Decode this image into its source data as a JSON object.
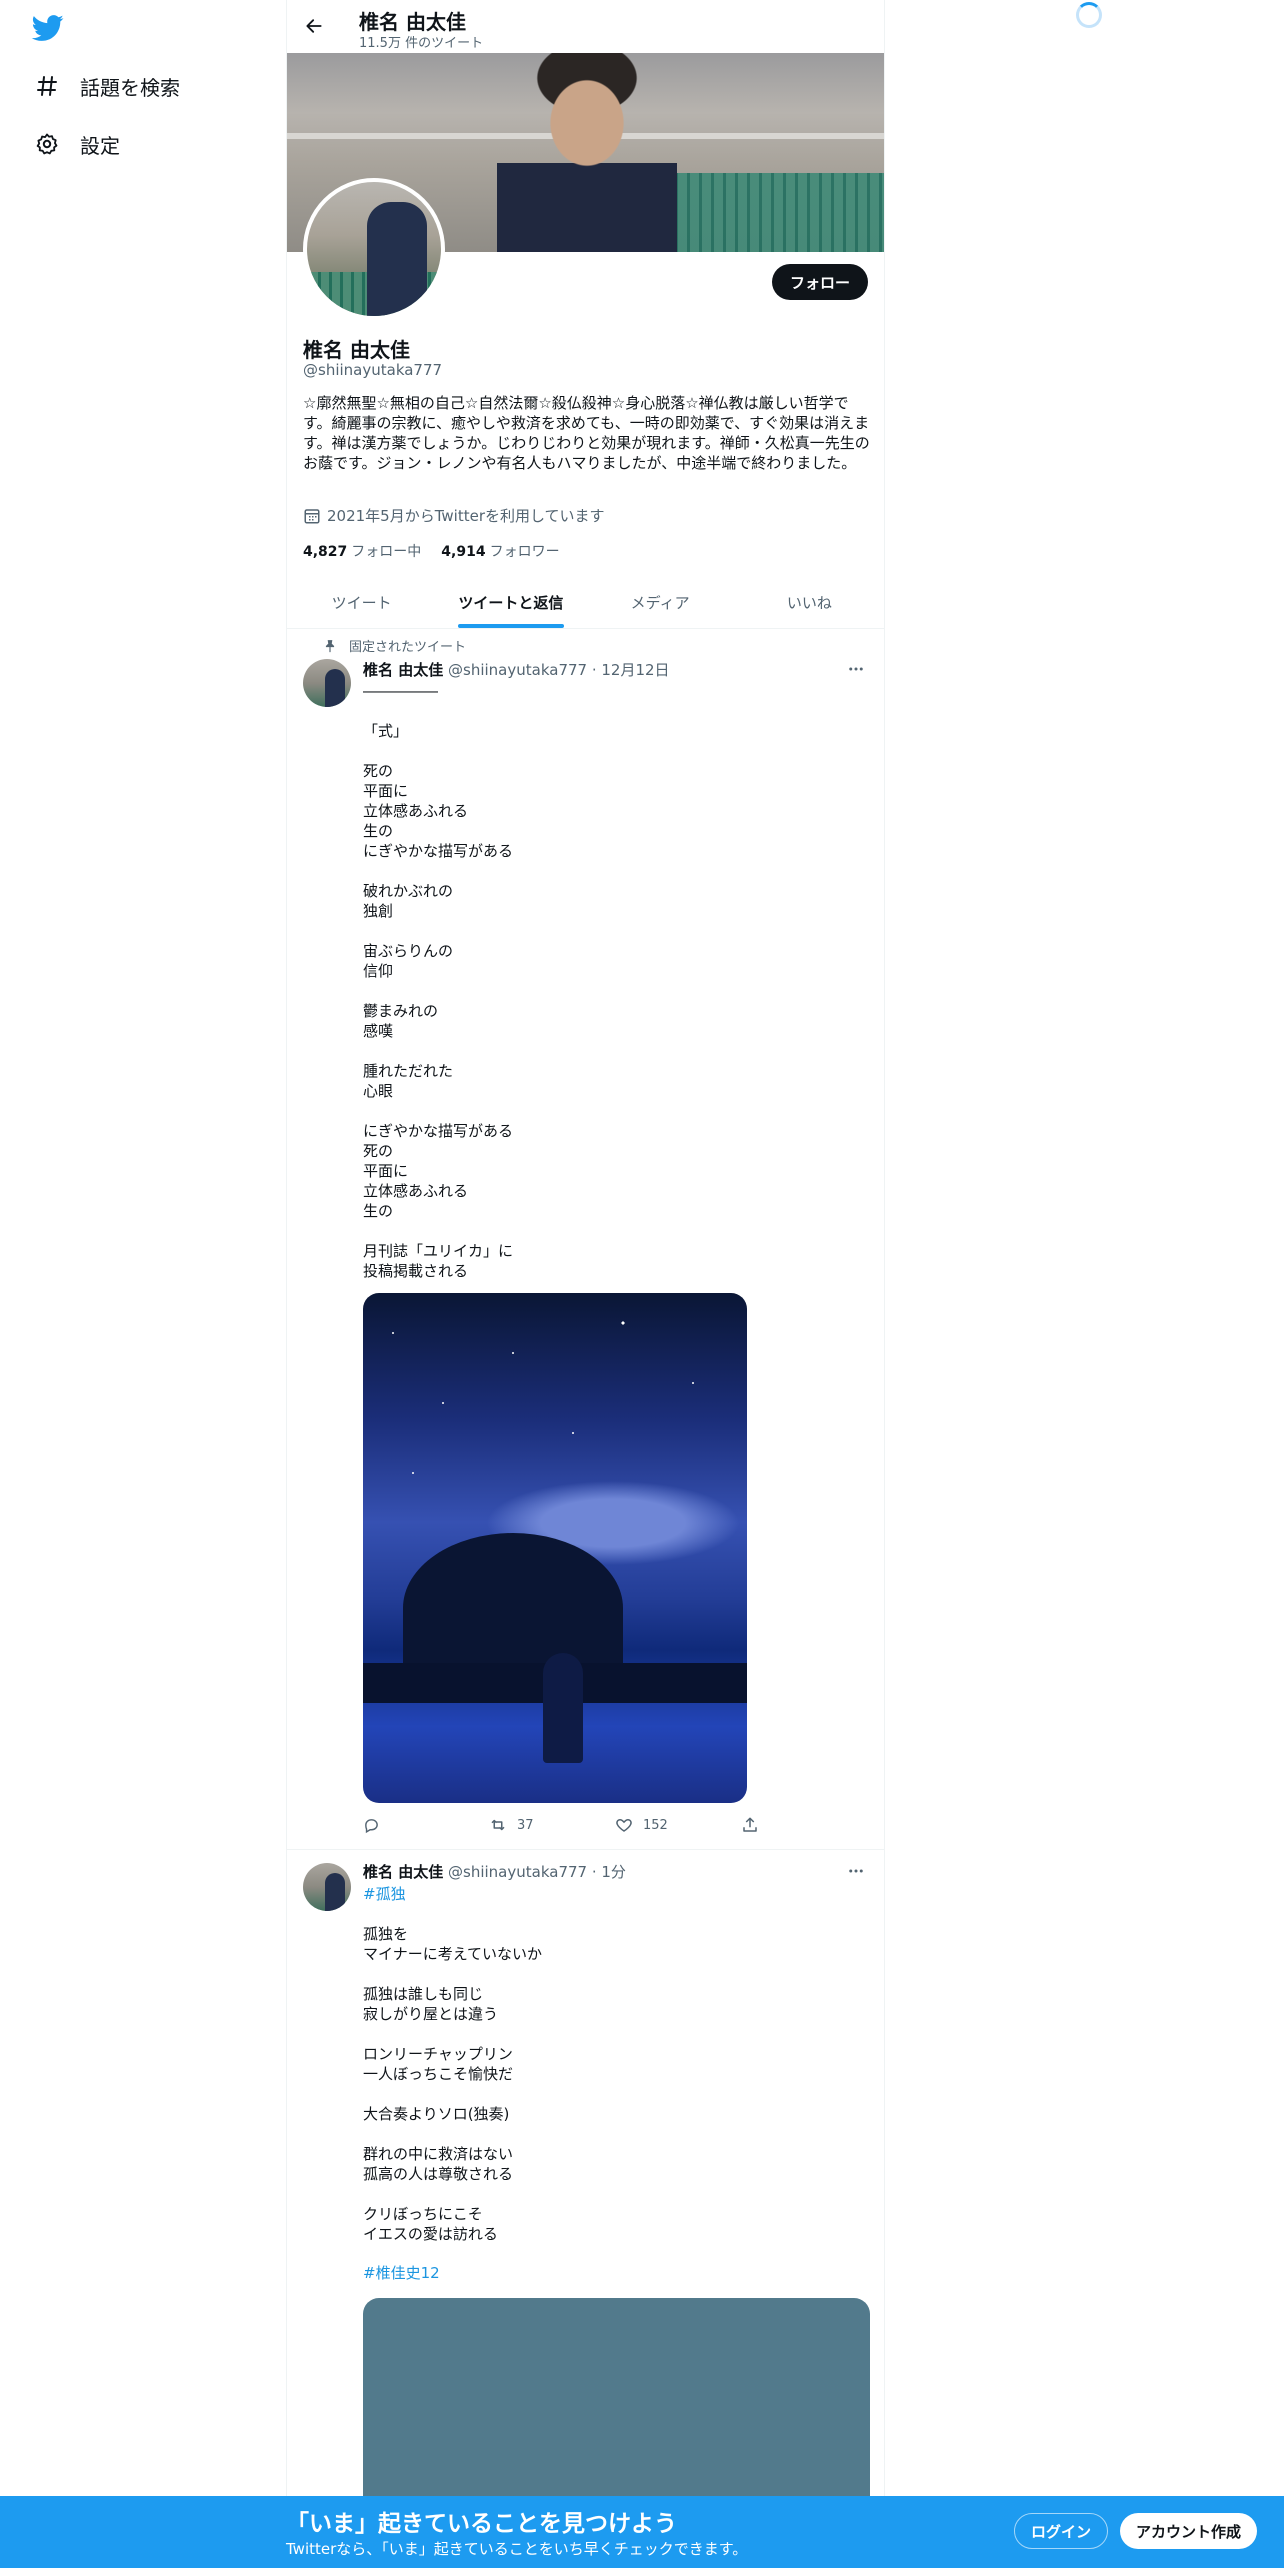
{
  "sidebar": {
    "logo": "twitter-bird-icon",
    "items": [
      {
        "label": "話題を検索",
        "icon": "hashtag-icon"
      },
      {
        "label": "設定",
        "icon": "gear-icon"
      }
    ]
  },
  "header": {
    "title": "椎名 由太佳",
    "subtitle": "11.5万 件のツイート"
  },
  "profile": {
    "name": "椎名 由太佳",
    "handle": "@shiinayutaka777",
    "bio": "☆廓然無聖☆無相の自己☆自然法爾☆殺仏殺神☆身心脱落☆禅仏教は厳しい哲学です。綺麗事の宗教に、癒やしや救済を求めても、一時の即効薬で、すぐ効果は消えます。禅は漢方薬でしょうか。じわりじわりと効果が現れます。禅師・久松真一先生のお蔭です。ジョン・レノンや有名人もハマりましたが、中途半端で終わりました。",
    "joined": "2021年5月からTwitterを利用しています",
    "following_count": "4,827",
    "following_label": "フォロー中",
    "followers_count": "4,914",
    "followers_label": "フォロワー",
    "follow_button": "フォロー"
  },
  "tabs": [
    {
      "label": "ツイート",
      "active": false
    },
    {
      "label": "ツイートと返信",
      "active": true
    },
    {
      "label": "メディア",
      "active": false
    },
    {
      "label": "いいね",
      "active": false
    }
  ],
  "tweets": [
    {
      "pinned_label": "固定されたツイート",
      "name": "椎名 由太佳",
      "meta": "@shiinayutaka777 · 12月12日",
      "body": "―――――\n\n「式」\n\n死の\n平面に\n立体感あふれる\n生の\nにぎやかな描写がある\n\n破れかぶれの\n独創\n\n宙ぶらりんの\n信仰\n\n鬱まみれの\n感嘆\n\n腫れただれた\n心眼\n\nにぎやかな描写がある\n死の\n平面に\n立体感あふれる\n生の\n\n月刊誌「ユリイカ」に\n投稿掲載される",
      "retweets": "37",
      "likes": "152"
    },
    {
      "name": "椎名 由太佳",
      "meta": "@shiinayutaka777 · 1分",
      "hashtag_top": "#孤独",
      "body": "孤独を\nマイナーに考えていないか\n\n孤独は誰しも同じ\n寂しがり屋とは違う\n\nロンリーチャップリン\n一人ぼっちこそ愉快だ\n\n大合奏よりソロ(独奏)\n\n群れの中に救済はない\n孤高の人は尊敬される\n\nクリぼっちにこそ\nイエスの愛は訪れる",
      "hashtag_bottom": "#椎佳史12"
    }
  ],
  "bottom_bar": {
    "title": "「いま」起きていることを見つけよう",
    "subtitle": "Twitterなら、「いま」起きていることをいち早くチェックできます。",
    "login": "ログイン",
    "signup": "アカウント作成"
  },
  "colors": {
    "accent": "#1d9bf0",
    "text": "#0f1419",
    "secondary": "#536471"
  }
}
